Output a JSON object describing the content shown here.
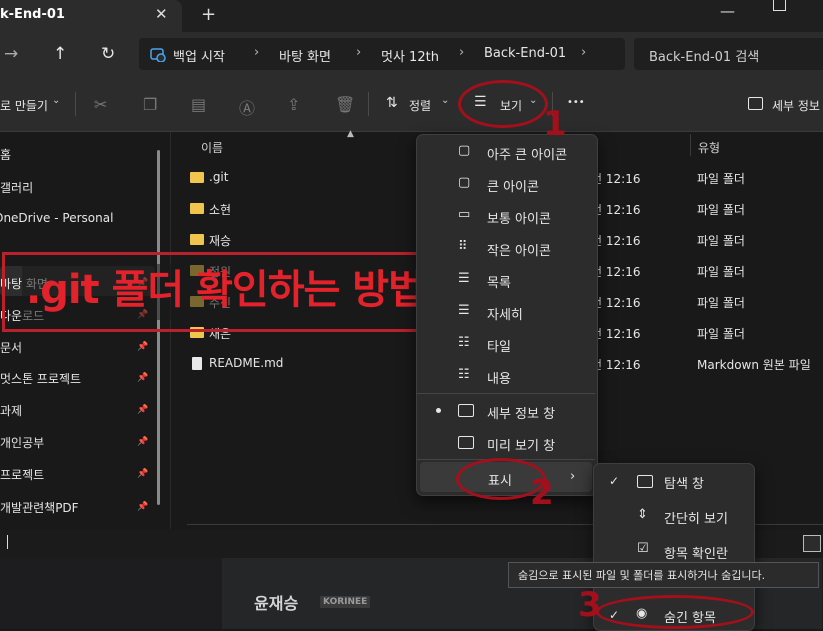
{
  "window": {
    "tab_title": "k-End-01",
    "tab_close": "✕",
    "new_tab": "+"
  },
  "address": {
    "crumbs": [
      "백업 시작",
      "바탕 화면",
      "멋사 12th",
      "Back-End-01"
    ],
    "separator": "›",
    "search_placeholder": "Back-End-01 검색"
  },
  "toolbar": {
    "new_label": "로 만들기",
    "sort_label": "정렬",
    "view_label": "보기",
    "more_label": "•••",
    "details_label": "세부 정보"
  },
  "sidebar": {
    "items": [
      {
        "label": "홈",
        "pinned": false
      },
      {
        "label": "갤러리",
        "pinned": false
      },
      {
        "label": "OneDrive - Personal",
        "pinned": false
      },
      {
        "label": "바탕 화면",
        "pinned": true
      },
      {
        "label": "다운로드",
        "pinned": true
      },
      {
        "label": "문서",
        "pinned": true
      },
      {
        "label": "멋스톤 프로젝트",
        "pinned": true
      },
      {
        "label": "과제",
        "pinned": true
      },
      {
        "label": "개인공부",
        "pinned": true
      },
      {
        "label": "프로젝트",
        "pinned": true
      },
      {
        "label": "개발관련책PDF",
        "pinned": true
      }
    ]
  },
  "files": {
    "columns": {
      "name": "이름",
      "type": "유형"
    },
    "rows": [
      {
        "name": ".git",
        "date": "오전 12:16",
        "type": "파일 폴더",
        "kind": "folder"
      },
      {
        "name": "소현",
        "date": "오전 12:16",
        "type": "파일 폴더",
        "kind": "folder"
      },
      {
        "name": "재승",
        "date": "오전 12:16",
        "type": "파일 폴더",
        "kind": "folder"
      },
      {
        "name": "정원",
        "date": "오전 12:16",
        "type": "파일 폴더",
        "kind": "folder"
      },
      {
        "name": "주신",
        "date": "오전 12:16",
        "type": "파일 폴더",
        "kind": "folder"
      },
      {
        "name": "채은",
        "date": "오전 12:16",
        "type": "파일 폴더",
        "kind": "folder"
      },
      {
        "name": "README.md",
        "date": "오전 12:16",
        "type": "Markdown 원본 파일",
        "kind": "file"
      }
    ]
  },
  "view_menu": {
    "items": [
      {
        "label": "아주 큰 아이콘",
        "icon": "square-large-icon"
      },
      {
        "label": "큰 아이콘",
        "icon": "square-icon"
      },
      {
        "label": "보통 아이콘",
        "icon": "monitor-icon"
      },
      {
        "label": "작은 아이콘",
        "icon": "grid-small-icon"
      },
      {
        "label": "목록",
        "icon": "list-icon"
      },
      {
        "label": "자세히",
        "icon": "details-icon"
      },
      {
        "label": "타일",
        "icon": "tiles-icon"
      },
      {
        "label": "내용",
        "icon": "content-icon"
      }
    ],
    "panes": [
      {
        "label": "세부 정보 창",
        "selected": true
      },
      {
        "label": "미리 보기 창",
        "selected": false
      }
    ],
    "show_label": "표시"
  },
  "show_submenu": {
    "items": [
      {
        "label": "탐색 창",
        "checked": true
      },
      {
        "label": "간단히 보기",
        "checked": false
      },
      {
        "label": "항목 확인란",
        "checked": false
      },
      {
        "label": "숨긴 항목",
        "checked": true
      }
    ]
  },
  "tooltip": "숨김으로 표시된 파일 및 폴더를 표시하거나 숨깁니다.",
  "page_below": {
    "author": "윤재승",
    "author_tag": "KORINEE"
  },
  "annotations": {
    "banner": ".git 폴더 확인하는 방법",
    "numbers": [
      "1",
      "2",
      "3"
    ],
    "color": "#c0202c"
  }
}
